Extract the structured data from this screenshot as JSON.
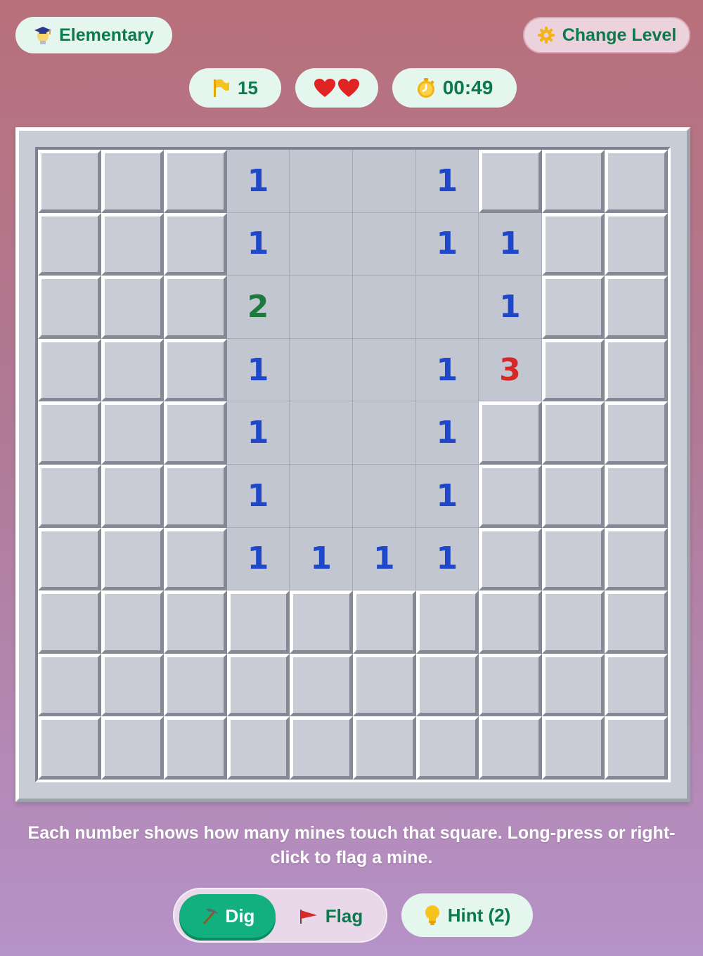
{
  "header": {
    "level_label": "Elementary",
    "level_icon": "graduation-bulb-icon",
    "change_level_label": "Change Level",
    "change_level_icon": "gear-icon"
  },
  "status": {
    "flags_count": "15",
    "lives": 2,
    "timer": "00:49"
  },
  "board": {
    "rows": 10,
    "cols": 10,
    "cells": [
      [
        "h",
        "h",
        "h",
        "1",
        "e",
        "e",
        "1",
        "h",
        "h",
        "h"
      ],
      [
        "h",
        "h",
        "h",
        "1",
        "e",
        "e",
        "1",
        "1",
        "h",
        "h"
      ],
      [
        "h",
        "h",
        "h",
        "2",
        "e",
        "e",
        "e",
        "1",
        "h",
        "h"
      ],
      [
        "h",
        "h",
        "h",
        "1",
        "e",
        "e",
        "1",
        "3",
        "h",
        "h"
      ],
      [
        "h",
        "h",
        "h",
        "1",
        "e",
        "e",
        "1",
        "h",
        "h",
        "h"
      ],
      [
        "h",
        "h",
        "h",
        "1",
        "e",
        "e",
        "1",
        "h",
        "h",
        "h"
      ],
      [
        "h",
        "h",
        "h",
        "1",
        "1",
        "1",
        "1",
        "h",
        "h",
        "h"
      ],
      [
        "h",
        "h",
        "h",
        "h",
        "h",
        "h",
        "h",
        "h",
        "h",
        "h"
      ],
      [
        "h",
        "h",
        "h",
        "h",
        "h",
        "h",
        "h",
        "h",
        "h",
        "h"
      ],
      [
        "h",
        "h",
        "h",
        "h",
        "h",
        "h",
        "h",
        "h",
        "h",
        "h"
      ]
    ],
    "number_colors": {
      "1": "#1f47c9",
      "2": "#1c7a3c",
      "3": "#d62828"
    }
  },
  "instructions": "Each number shows how many mines touch that square. Long-press or right-click to flag a mine.",
  "controls": {
    "dig_label": "Dig",
    "flag_label": "Flag",
    "hint_label": "Hint (2)",
    "active_mode": "dig"
  },
  "colors": {
    "accent": "#12b07e",
    "text_green": "#0b7a4c"
  }
}
